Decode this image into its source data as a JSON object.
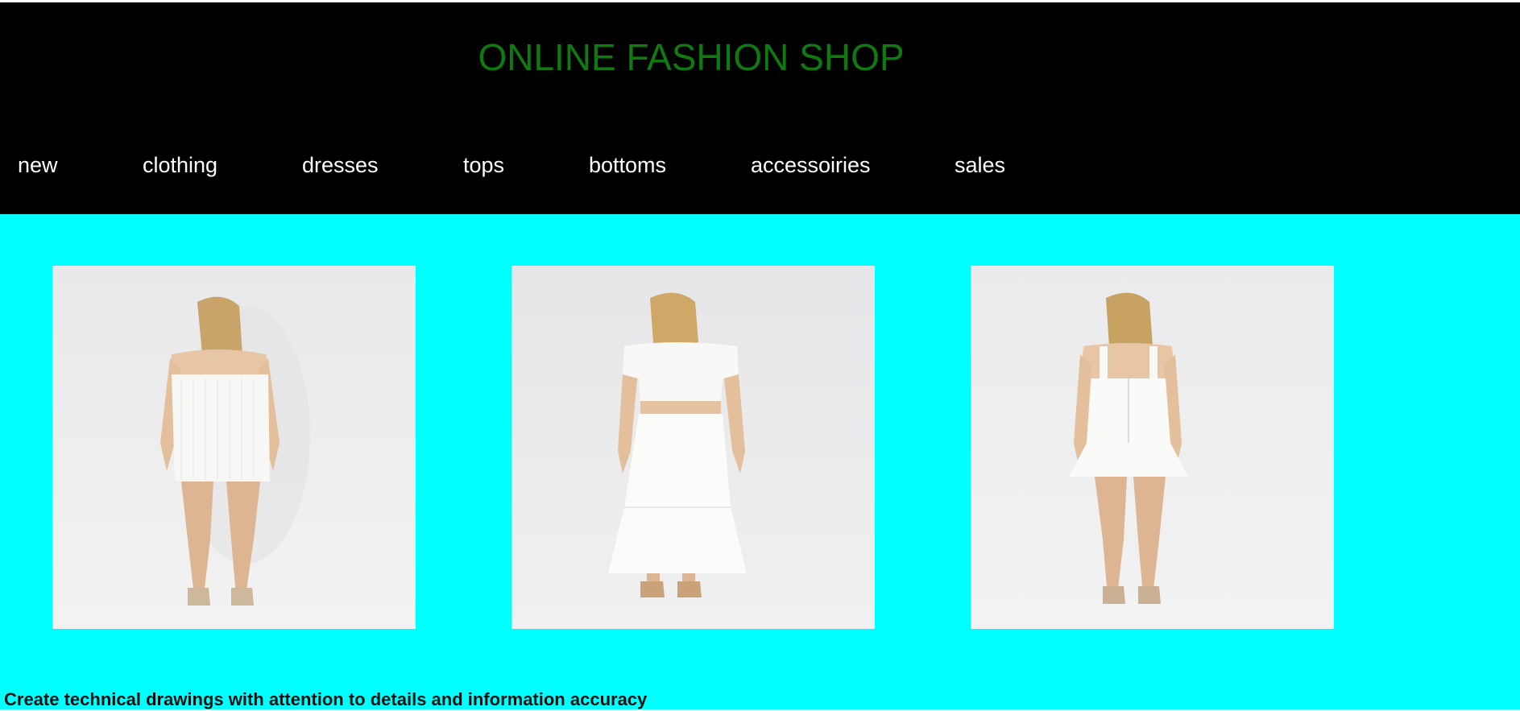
{
  "header": {
    "title": "ONLINE FASHION SHOP",
    "title_color": "#0f7a0f",
    "background": "#000000"
  },
  "nav": {
    "items": [
      {
        "label": "new"
      },
      {
        "label": "clothing"
      },
      {
        "label": "dresses"
      },
      {
        "label": "tops"
      },
      {
        "label": "bottoms"
      },
      {
        "label": "accessoiries"
      },
      {
        "label": "sales"
      }
    ],
    "text_color": "#ffffff"
  },
  "main": {
    "background": "#00ffff",
    "products": [
      {
        "image": "strapless-white-mini-dress-back-view"
      },
      {
        "image": "white-crop-top-and-tiered-maxi-skirt-back-view"
      },
      {
        "image": "white-strappy-mini-dress-back-view"
      }
    ]
  },
  "footer": {
    "text": "Create technical drawings with attention to details and information accuracy"
  }
}
